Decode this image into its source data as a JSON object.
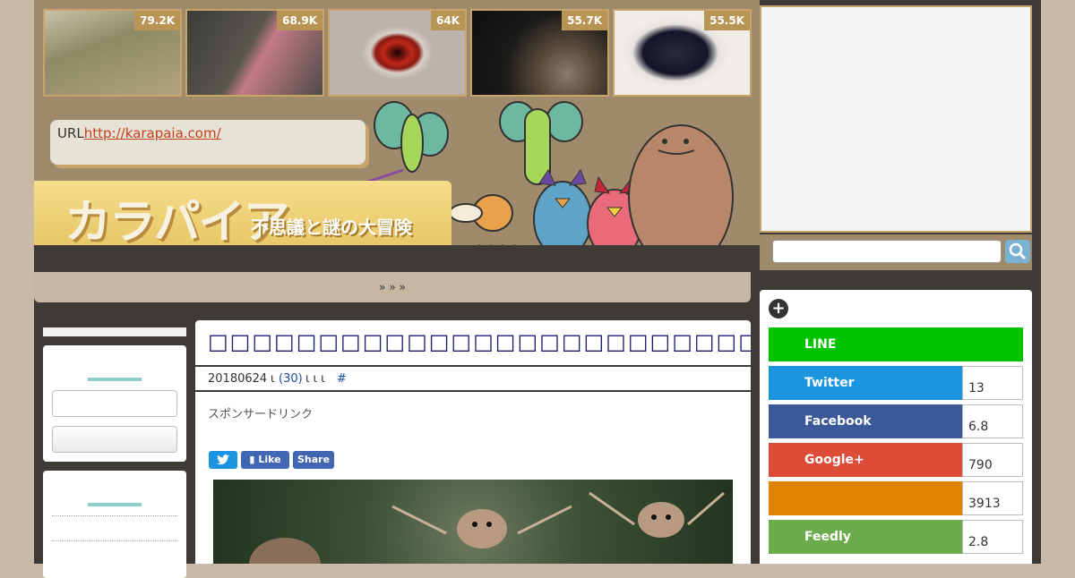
{
  "thumbnails": [
    {
      "count": "79.2K",
      "color_a": "#8a8a6a",
      "color_b": "#b7a98a"
    },
    {
      "count": "68.9K",
      "color_a": "#4a4a45",
      "color_b": "#b07060"
    },
    {
      "count": "64K",
      "color_a": "#d0c6c0",
      "color_b": "#c0281a"
    },
    {
      "count": "55.7K",
      "color_a": "#1c1c1c",
      "color_b": "#7a6a5a"
    },
    {
      "count": "55.5K",
      "color_a": "#e9e7e4",
      "color_b": "#1a1a28"
    }
  ],
  "url_box": {
    "label": "URL",
    "link": "http://karapaia.com/"
  },
  "logo": {
    "name": "カラパイア",
    "tagline": "不思議と謎の大冒険"
  },
  "nav": {
    "breadcrumb": "» » »"
  },
  "article": {
    "title": "□□□□□□□□□□□□□□□□□□□□□□□□□□□□□□□□□□□□□□□",
    "date": "20180624",
    "sep1": "ι",
    "comments": "(30)",
    "sep2": "ι ι ι",
    "hash": "#",
    "sponsor": "スポンサードリンク",
    "share_like": "Like",
    "share_share": "Share"
  },
  "social": [
    {
      "name": "LINE",
      "count": "",
      "color": "#00c300"
    },
    {
      "name": "Twitter",
      "count": "13",
      "color": "#1b95e0"
    },
    {
      "name": "Facebook",
      "count": "6.8",
      "color": "#3b5998"
    },
    {
      "name": "Google+",
      "count": "790",
      "color": "#dd4b39"
    },
    {
      "name": "",
      "count": "3913",
      "color": "#e08300"
    },
    {
      "name": "Feedly",
      "count": "2.8",
      "color": "#6cc655"
    }
  ]
}
